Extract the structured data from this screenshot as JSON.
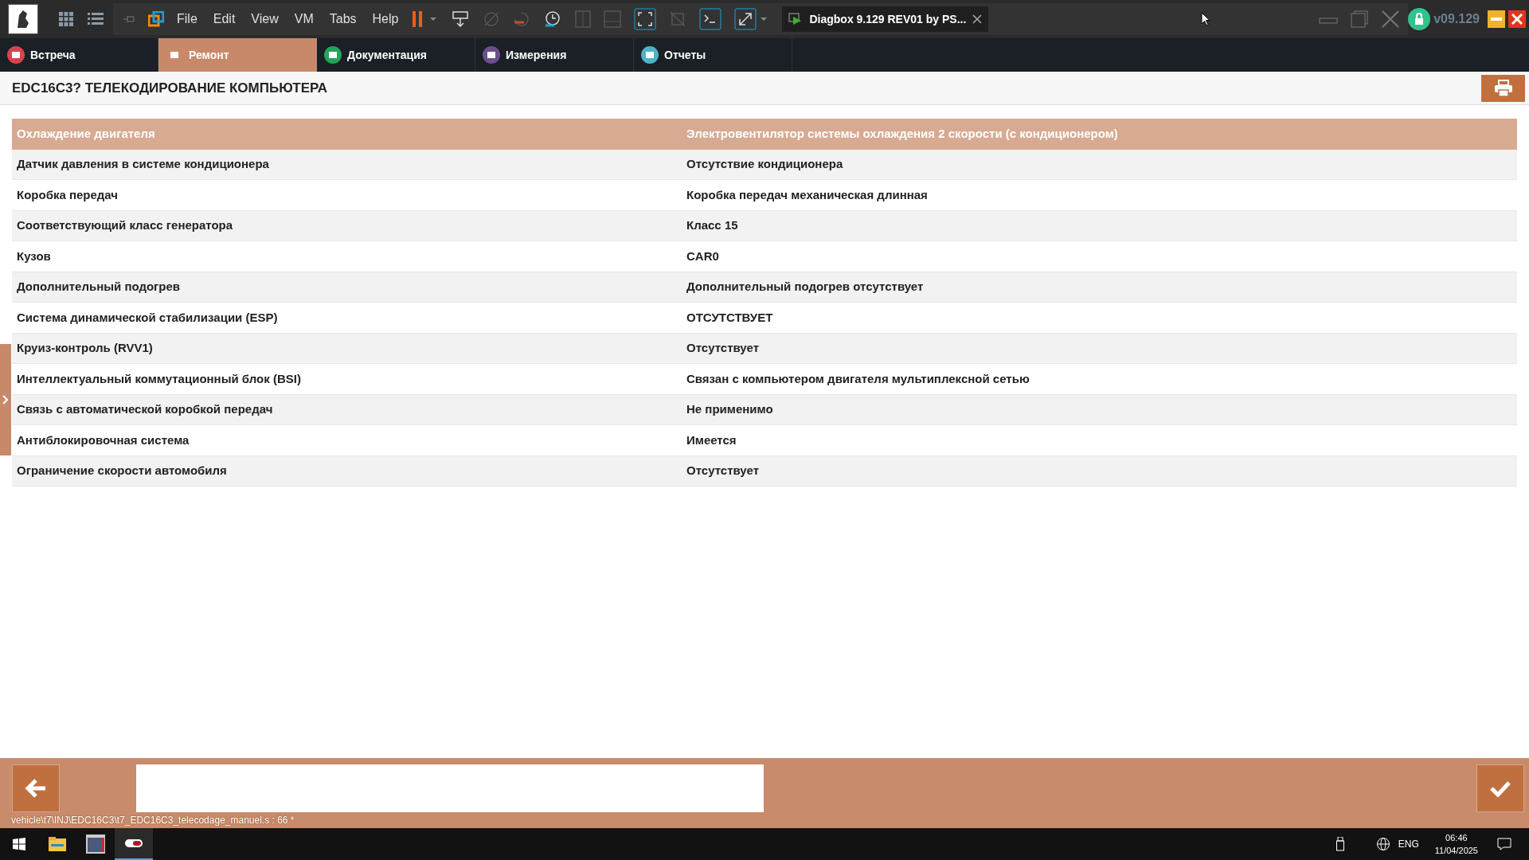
{
  "menu": [
    "File",
    "Edit",
    "View",
    "VM",
    "Tabs",
    "Help"
  ],
  "vm_tab": {
    "title": "Diagbox 9.129 REV01 by PS..."
  },
  "version": "v09.129",
  "tabs": [
    {
      "label": "Встреча",
      "selected": false,
      "color": "#d9434b"
    },
    {
      "label": "Ремонт",
      "selected": true
    },
    {
      "label": "Документация",
      "selected": false,
      "color": "#22a559"
    },
    {
      "label": "Измерения",
      "selected": false,
      "color": "#6c4f8a"
    },
    {
      "label": "Отчеты",
      "selected": false,
      "color": "#4fb3c9"
    }
  ],
  "page_title": "EDC16C3? ТЕЛЕКОДИРОВАНИЕ КОМПЬЮТЕРА",
  "table": {
    "header": [
      "Охлаждение двигателя",
      "Электровентилятор системы охлаждения 2 скорости (с кондиционером)"
    ],
    "rows": [
      [
        "Датчик давления в системе кондиционера",
        "Отсутствие кондиционера"
      ],
      [
        "Коробка передач",
        "Коробка передач механическая длинная"
      ],
      [
        "Соответствующий класс генератора",
        "Класс 15"
      ],
      [
        "Кузов",
        "CAR0"
      ],
      [
        "Дополнительный подогрев",
        "Дополнительный подогрев отсутствует"
      ],
      [
        "Система динамической стабилизации (ESP)",
        "ОТСУТСТВУЕТ"
      ],
      [
        "Круиз-контроль (RVV1)",
        "Отсутствует"
      ],
      [
        "Интеллектуальный коммутационный блок (BSI)",
        "Связан с компьютером двигателя мультиплексной сетью"
      ],
      [
        "Связь с автоматической коробкой передач",
        "Не применимо"
      ],
      [
        "Антиблокировочная система",
        "Имеется"
      ],
      [
        "Ограничение скорости автомобиля",
        "Отсутствует"
      ]
    ]
  },
  "status_path": "vehicle\\t7\\INJ\\EDC16C3\\t7_EDC16C3_telecodage_manuel.s : 66 *",
  "taskbar": {
    "language": "ENG",
    "time": "06:46",
    "date": "11/04/2025"
  }
}
